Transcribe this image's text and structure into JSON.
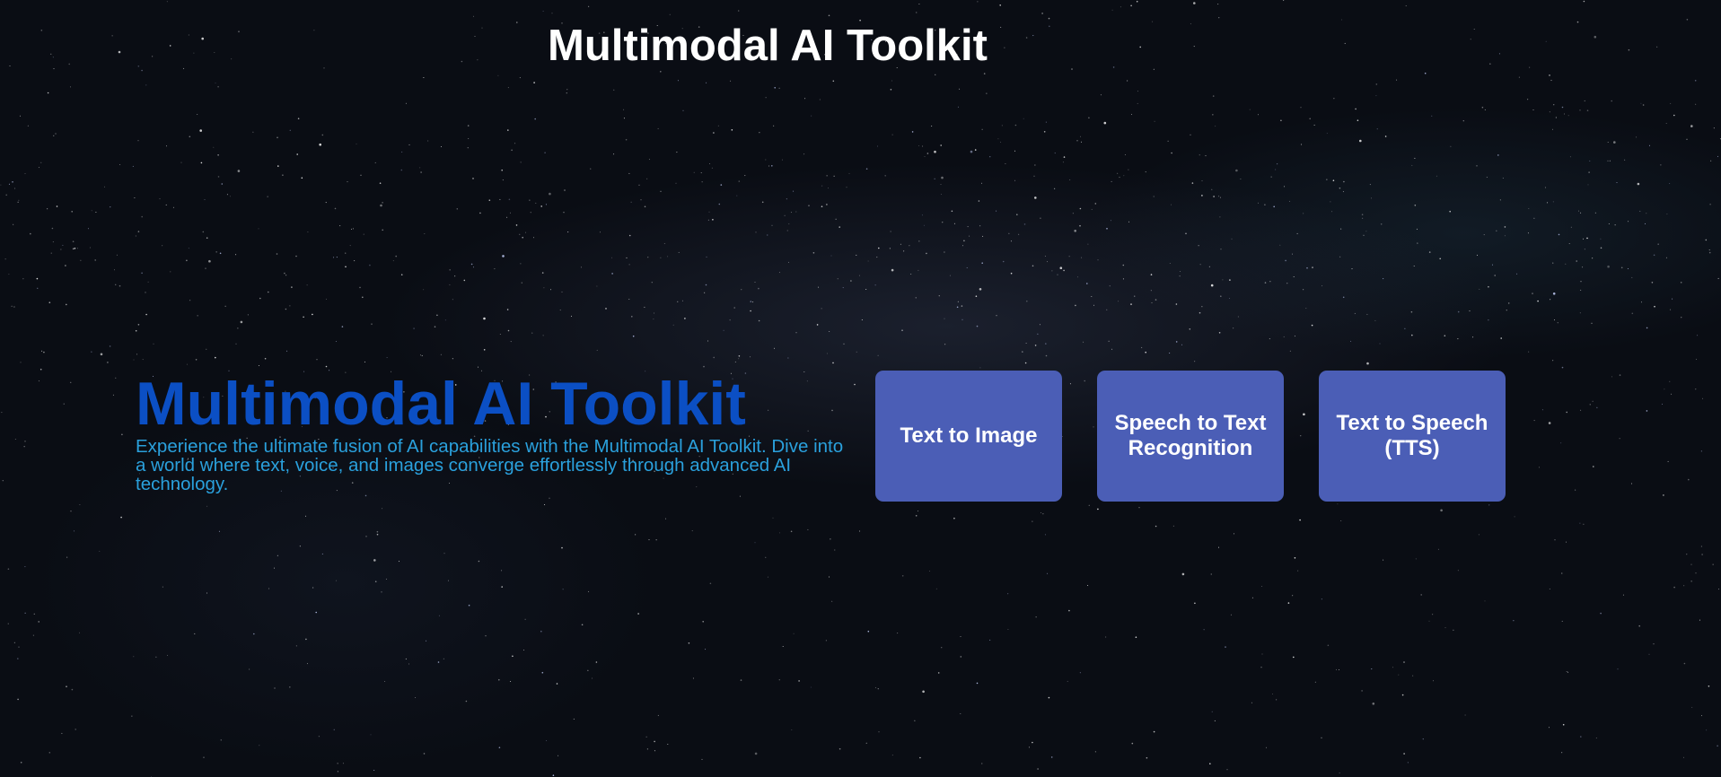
{
  "header": {
    "title": "Multimodal AI Toolkit"
  },
  "hero": {
    "title": "Multimodal AI Toolkit",
    "description": "Experience the ultimate fusion of AI capabilities with the Multimodal AI Toolkit. Dive into a world where text, voice, and images converge effortlessly through advanced AI technology."
  },
  "tools": [
    {
      "label": "Text to Image"
    },
    {
      "label": "Speech to Text Recognition"
    },
    {
      "label": "Text to Speech (TTS)"
    }
  ],
  "colors": {
    "background": "#0a0d14",
    "hero_title": "#0b4fc4",
    "hero_description": "#2aa0dc",
    "card_background": "#4b5eb6",
    "card_text": "#ffffff"
  }
}
